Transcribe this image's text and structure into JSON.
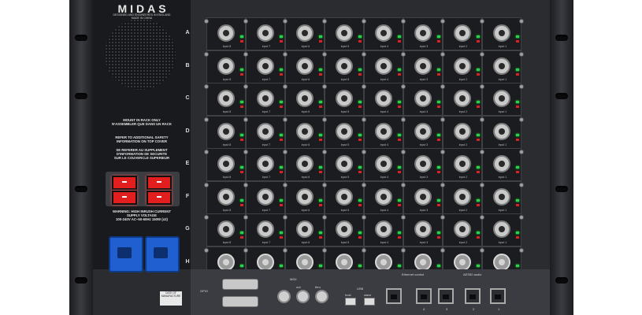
{
  "brand": {
    "logo": "MIDAS",
    "tagline": "DESIGNED AND ENGINEERED IN ENGLAND",
    "made_in": "MADE IN CHINA"
  },
  "warnings": {
    "rack_mount": [
      "MOUNT IN RACK ONLY",
      "N'ASSEMBLER QUE DANS UN RACK"
    ],
    "safety": [
      "REFER TO ADDITIONAL SAFETY",
      "INFORMATION ON TOP COVER"
    ],
    "safety_fr": [
      "SE REFERER AU SUPPLEMENT",
      "D'INFORMATION DE SECURITE",
      "SUR LE COUVERCLE SUPERIEUR"
    ],
    "inrush": [
      "WARNING: HIGH INRUSH CURRENT",
      "SUPPLY VOLTAGE"
    ],
    "rating": "100-240V  AC~50-60Hz 150W (x2)"
  },
  "rows": [
    "A",
    "B",
    "C",
    "D",
    "E",
    "F",
    "G",
    "H"
  ],
  "input_labels": [
    "input 8",
    "input 7",
    "input 6",
    "input 5",
    "input 4",
    "input 3",
    "input 2",
    "input 1"
  ],
  "output_labels": [
    "output 8",
    "output 7",
    "output 6",
    "output 5",
    "output 4",
    "output 3",
    "output 2",
    "output 1"
  ],
  "bottom": {
    "gpio": "GPIO",
    "midi": "MIDI",
    "midi_ports": [
      "out",
      "thru"
    ],
    "usb": "USB",
    "usb_ports": [
      "host",
      "slave"
    ],
    "ethernet_label": "Ethernet control",
    "aes50_label": "AES50 audio",
    "rj_numbers": [
      "4",
      "3",
      "2",
      "1"
    ],
    "date_label": "DATE OF MANUFACTURE"
  },
  "colors": {
    "power_switch": "#e21e1e",
    "iec_inlet": "#1f5fcf",
    "led_green": "#22d64c",
    "led_red": "#de2020"
  }
}
